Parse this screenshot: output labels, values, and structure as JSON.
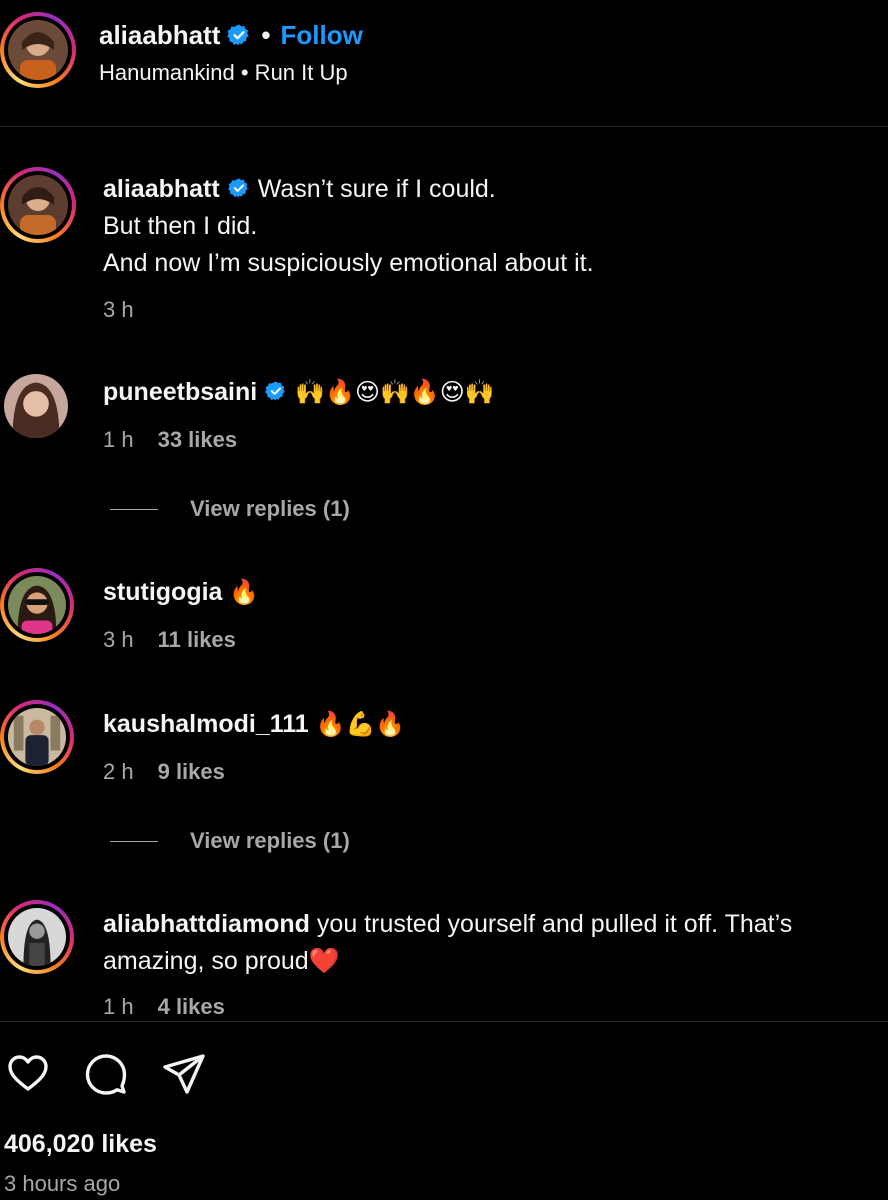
{
  "header": {
    "username": "aliaabhatt",
    "separator": "•",
    "follow_label": "Follow",
    "subtitle": "Hanumankind • Run It Up"
  },
  "comments": [
    {
      "username": "aliaabhatt",
      "verified": true,
      "lines": [
        "Wasn’t sure if I could.",
        "But then I did.",
        "And now I’m suspiciously emotional about it."
      ],
      "time": "3 h"
    },
    {
      "username": "puneetbsaini",
      "verified": true,
      "text": "🙌🔥😍🙌🔥😍🙌",
      "time": "1 h",
      "likes": "33 likes",
      "view_replies": "View replies (1)"
    },
    {
      "username": "stutigogia",
      "verified": false,
      "text": "🔥",
      "time": "3 h",
      "likes": "11 likes"
    },
    {
      "username": "kaushalmodi_111",
      "verified": false,
      "text": "🔥💪🔥",
      "time": "2 h",
      "likes": "9 likes",
      "view_replies": "View replies (1)"
    },
    {
      "username": "aliabhattdiamond",
      "verified": false,
      "text": "you trusted yourself and pulled it off. That’s amazing, so proud❤️",
      "time": "1 h",
      "likes": "4 likes"
    }
  ],
  "footer": {
    "likes": "406,020 likes",
    "time_ago": "3 hours ago"
  },
  "icons": {
    "verified": "verified-badge-icon",
    "like": "heart-icon",
    "comment": "comment-bubble-icon",
    "share": "paper-plane-icon"
  },
  "colors": {
    "background": "#000000",
    "text": "#f5f5f5",
    "secondary": "#a8a8a8",
    "link": "#1a9bff",
    "verified": "#1a9bff"
  }
}
